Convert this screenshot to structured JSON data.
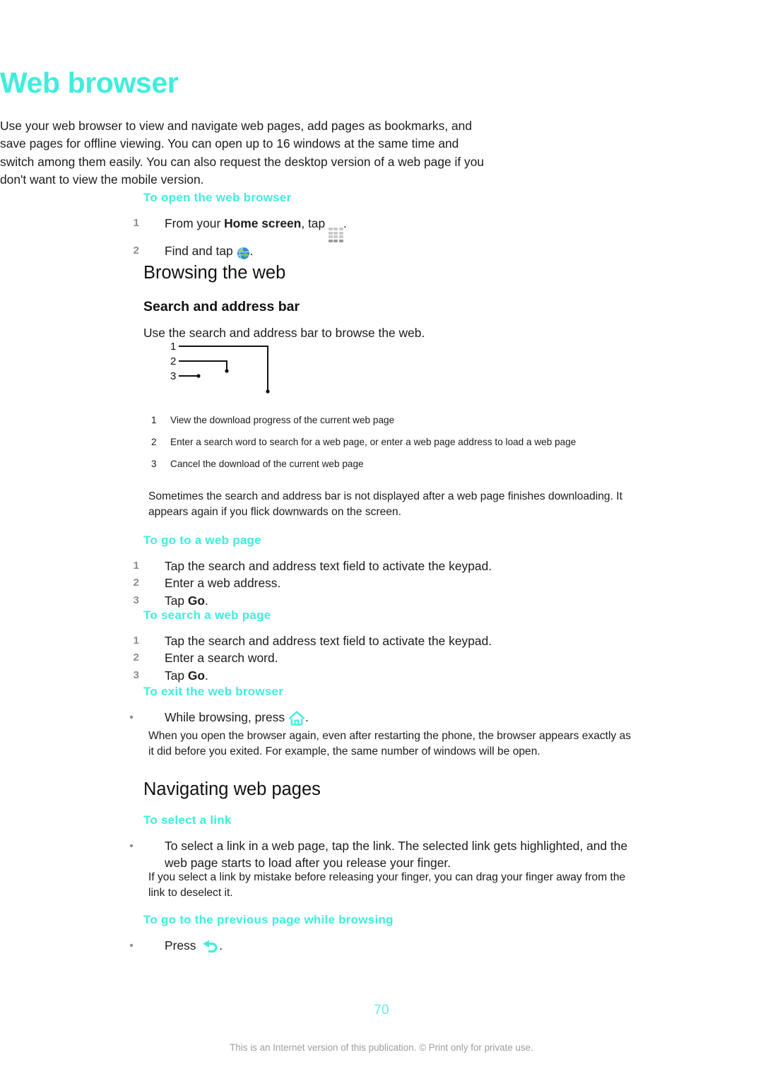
{
  "document": {
    "title": "Web browser",
    "page_number": "70",
    "footer": "This is an Internet version of this publication. © Print only for private use."
  },
  "intro": {
    "paragraph": "Use your web browser to view and navigate web pages, add pages as bookmarks, and save pages for offline viewing. You can open up to 16 windows at the same time and switch among them easily. You can also request the desktop version of a web page if you don't want to view the mobile version."
  },
  "open_browser": {
    "heading": "To open the web browser",
    "steps": [
      {
        "num": "1",
        "pre": "From your ",
        "bold": "Home screen",
        "post": ", tap ",
        "icon": "app-grid-icon",
        "tail": "."
      },
      {
        "num": "2",
        "pre": "Find and tap ",
        "bold": "",
        "post": "",
        "icon": "globe-icon",
        "tail": "."
      }
    ]
  },
  "browsing_section": {
    "heading": "Browsing the web",
    "search_bar": {
      "heading": "Search and address bar",
      "body": "Use the search and address bar to browse the web.",
      "figure_labels": [
        "1",
        "2",
        "3"
      ],
      "captions": [
        {
          "num": "1",
          "text": "View the download progress of the current web page"
        },
        {
          "num": "2",
          "text": "Enter a search word to search for a web page, or enter a web page address to load a web page"
        },
        {
          "num": "3",
          "text": "Cancel the download of the current web page"
        }
      ],
      "note": "Sometimes the search and address bar is not displayed after a web page finishes downloading. It appears again if you flick downwards on the screen."
    },
    "go_to_web_page": {
      "heading": "To go to a web page",
      "steps": [
        {
          "num": "1",
          "pre": "Tap the search and address text field to activate the keypad.",
          "bold": "",
          "post": ""
        },
        {
          "num": "2",
          "pre": "Enter a web address.",
          "bold": "",
          "post": ""
        },
        {
          "num": "3",
          "pre": "Tap ",
          "bold": "Go",
          "post": "."
        }
      ]
    },
    "search_web_page": {
      "heading": "To search a web page",
      "steps": [
        {
          "num": "1",
          "pre": "Tap the search and address text field to activate the keypad.",
          "bold": "",
          "post": ""
        },
        {
          "num": "2",
          "pre": "Enter a search word.",
          "bold": "",
          "post": ""
        },
        {
          "num": "3",
          "pre": "Tap ",
          "bold": "Go",
          "post": "."
        }
      ]
    },
    "exit_browser": {
      "heading": "To exit the web browser",
      "bullet_pre": "While browsing, press ",
      "bullet_icon": "home-icon",
      "bullet_tail": ".",
      "note": "When you open the browser again, even after restarting the phone, the browser appears exactly as it did before you exited. For example, the same number of windows will be open."
    }
  },
  "navigating_section": {
    "heading": "Navigating web pages",
    "select_link": {
      "heading": "To select a link",
      "bullet": "To select a link in a web page, tap the link. The selected link gets highlighted, and the web page starts to load after you release your finger.",
      "note": "If you select a link by mistake before releasing your finger, you can drag your finger away from the link to deselect it."
    },
    "previous_page": {
      "heading": "To go to the previous page while browsing",
      "bullet_pre": "Press ",
      "bullet_icon": "back-arrow-icon",
      "bullet_tail": "."
    }
  },
  "colors": {
    "accent": "#3EEEDC",
    "text": "#1c1c1c",
    "muted": "#8d8d8d",
    "footer": "#9d9d9d"
  }
}
